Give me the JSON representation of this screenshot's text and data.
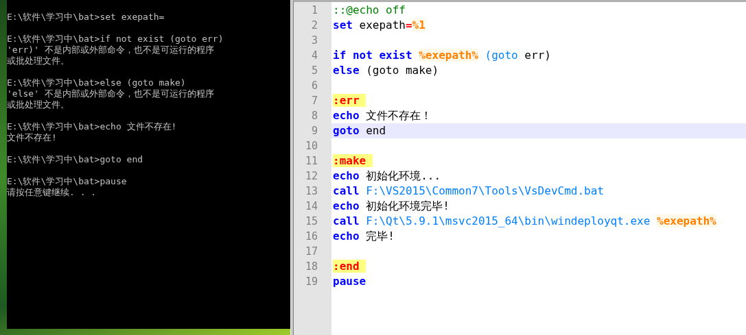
{
  "console": {
    "blocks": [
      [
        "E:\\软件\\学习中\\bat>set exepath="
      ],
      [
        "E:\\软件\\学习中\\bat>if not exist (goto err)",
        "'err)' 不是内部或外部命令，也不是可运行的程序",
        "或批处理文件。"
      ],
      [
        "E:\\软件\\学习中\\bat>else (goto make)",
        "'else' 不是内部或外部命令，也不是可运行的程序",
        "或批处理文件。"
      ],
      [
        "E:\\软件\\学习中\\bat>echo 文件不存在!",
        "文件不存在!"
      ],
      [
        "E:\\软件\\学习中\\bat>goto end"
      ],
      [
        "E:\\软件\\学习中\\bat>pause",
        "请按任意键继续. . ."
      ]
    ]
  },
  "editor": {
    "lines": [
      {
        "number": "1",
        "current": false,
        "tokens": [
          {
            "kind": "comment",
            "text": "::@echo off"
          }
        ]
      },
      {
        "number": "2",
        "current": false,
        "tokens": [
          {
            "kind": "keyword",
            "text": "set"
          },
          {
            "kind": "text",
            "text": " exepath"
          },
          {
            "kind": "operator",
            "text": "="
          },
          {
            "kind": "variable",
            "text": "%1"
          }
        ]
      },
      {
        "number": "3",
        "current": false
      },
      {
        "number": "4",
        "current": false,
        "tokens": [
          {
            "kind": "keyword",
            "text": "if not exist "
          },
          {
            "kind": "variable",
            "text": "%exepath%"
          },
          {
            "kind": "path",
            "text": " (goto"
          },
          {
            "kind": "text",
            "text": " err)"
          }
        ]
      },
      {
        "number": "5",
        "current": false,
        "tokens": [
          {
            "kind": "keyword",
            "text": "else"
          },
          {
            "kind": "text",
            "text": " (goto make)"
          }
        ]
      },
      {
        "number": "6",
        "current": false
      },
      {
        "number": "7",
        "current": false,
        "tokens": [
          {
            "kind": "label",
            "text": ":err "
          }
        ]
      },
      {
        "number": "8",
        "current": false,
        "tokens": [
          {
            "kind": "keyword",
            "text": "echo"
          },
          {
            "kind": "text",
            "text": " 文件不存在！"
          }
        ]
      },
      {
        "number": "9",
        "current": true,
        "tokens": [
          {
            "kind": "keyword",
            "text": "goto"
          },
          {
            "kind": "text",
            "text": " end"
          }
        ]
      },
      {
        "number": "10",
        "current": false
      },
      {
        "number": "11",
        "current": false,
        "tokens": [
          {
            "kind": "label",
            "text": ":make "
          }
        ]
      },
      {
        "number": "12",
        "current": false,
        "tokens": [
          {
            "kind": "keyword",
            "text": "echo"
          },
          {
            "kind": "text",
            "text": " 初始化环境..."
          }
        ]
      },
      {
        "number": "13",
        "current": false,
        "tokens": [
          {
            "kind": "keyword",
            "text": "call"
          },
          {
            "kind": "path",
            "text": " F:\\VS2015\\Common7\\Tools\\VsDevCmd.bat"
          }
        ]
      },
      {
        "number": "14",
        "current": false,
        "tokens": [
          {
            "kind": "keyword",
            "text": "echo"
          },
          {
            "kind": "text",
            "text": " 初始化环境完毕!"
          }
        ]
      },
      {
        "number": "15",
        "current": false,
        "tokens": [
          {
            "kind": "keyword",
            "text": "call"
          },
          {
            "kind": "path",
            "text": " F:\\Qt\\5.9.1\\msvc2015_64\\bin\\windeployqt.exe "
          },
          {
            "kind": "variable",
            "text": "%exepath%"
          }
        ]
      },
      {
        "number": "16",
        "current": false,
        "tokens": [
          {
            "kind": "keyword",
            "text": "echo"
          },
          {
            "kind": "text",
            "text": " 完毕!"
          }
        ]
      },
      {
        "number": "17",
        "current": false
      },
      {
        "number": "18",
        "current": false,
        "tokens": [
          {
            "kind": "label",
            "text": ":end "
          }
        ]
      },
      {
        "number": "19",
        "current": false,
        "tokens": [
          {
            "kind": "keyword",
            "text": "pause"
          }
        ]
      }
    ]
  }
}
